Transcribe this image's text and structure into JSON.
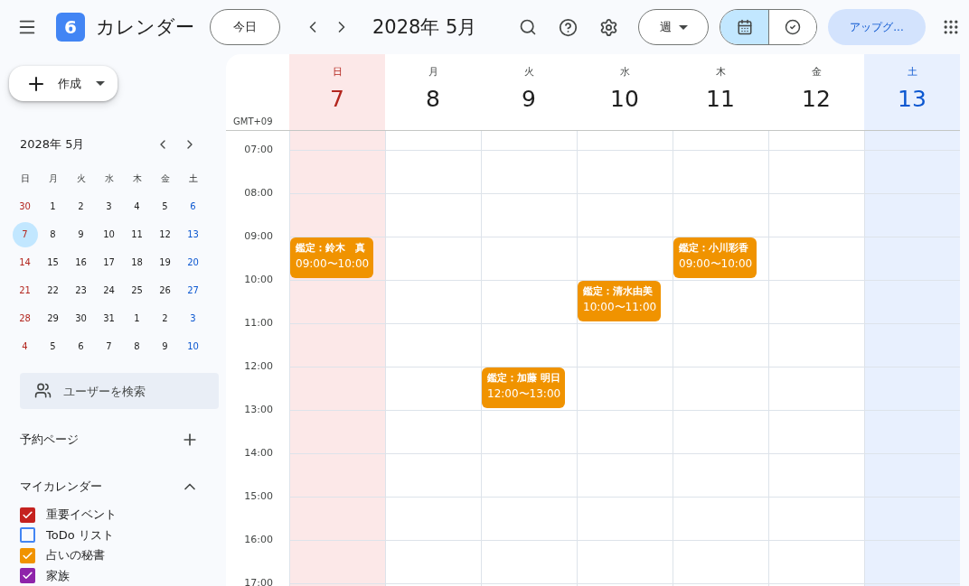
{
  "app": {
    "logo_text": "6",
    "title": "カレンダー"
  },
  "toolbar": {
    "today": "今日",
    "period": "2028年 5月",
    "view": "週",
    "view_mode": [
      {
        "kind": "calendar",
        "selected": true
      },
      {
        "kind": "tasks",
        "selected": false
      }
    ],
    "upgrade": "アップグ..."
  },
  "create_button": "作成",
  "mini_calendar": {
    "title": "2028年 5月",
    "weekdays": [
      {
        "label": "日",
        "kind": "sunday"
      },
      {
        "label": "月",
        "kind": "weekday"
      },
      {
        "label": "火",
        "kind": "weekday"
      },
      {
        "label": "水",
        "kind": "weekday"
      },
      {
        "label": "木",
        "kind": "weekday"
      },
      {
        "label": "金",
        "kind": "weekday"
      },
      {
        "label": "土",
        "kind": "saturday"
      }
    ],
    "weeks": [
      [
        {
          "d": "30",
          "selected": false
        },
        {
          "d": "1",
          "selected": false
        },
        {
          "d": "2",
          "selected": false
        },
        {
          "d": "3",
          "selected": false
        },
        {
          "d": "4",
          "selected": false
        },
        {
          "d": "5",
          "selected": false
        },
        {
          "d": "6",
          "selected": false
        }
      ],
      [
        {
          "d": "7",
          "selected": true
        },
        {
          "d": "8",
          "selected": false
        },
        {
          "d": "9",
          "selected": false
        },
        {
          "d": "10",
          "selected": false
        },
        {
          "d": "11",
          "selected": false
        },
        {
          "d": "12",
          "selected": false
        },
        {
          "d": "13",
          "selected": false
        }
      ],
      [
        {
          "d": "14",
          "selected": false
        },
        {
          "d": "15",
          "selected": false
        },
        {
          "d": "16",
          "selected": false
        },
        {
          "d": "17",
          "selected": false
        },
        {
          "d": "18",
          "selected": false
        },
        {
          "d": "19",
          "selected": false
        },
        {
          "d": "20",
          "selected": false
        }
      ],
      [
        {
          "d": "21",
          "selected": false
        },
        {
          "d": "22",
          "selected": false
        },
        {
          "d": "23",
          "selected": false
        },
        {
          "d": "24",
          "selected": false
        },
        {
          "d": "25",
          "selected": false
        },
        {
          "d": "26",
          "selected": false
        },
        {
          "d": "27",
          "selected": false
        }
      ],
      [
        {
          "d": "28",
          "selected": false
        },
        {
          "d": "29",
          "selected": false
        },
        {
          "d": "30",
          "selected": false
        },
        {
          "d": "31",
          "selected": false
        },
        {
          "d": "1",
          "selected": false
        },
        {
          "d": "2",
          "selected": false
        },
        {
          "d": "3",
          "selected": false
        }
      ],
      [
        {
          "d": "4",
          "selected": false
        },
        {
          "d": "5",
          "selected": false
        },
        {
          "d": "6",
          "selected": false
        },
        {
          "d": "7",
          "selected": false
        },
        {
          "d": "8",
          "selected": false
        },
        {
          "d": "9",
          "selected": false
        },
        {
          "d": "10",
          "selected": false
        }
      ]
    ]
  },
  "user_search": {
    "placeholder": "ユーザーを検索"
  },
  "booking_pages": {
    "title": "予約ページ"
  },
  "my_calendars": {
    "title": "マイカレンダー",
    "expanded": true,
    "items": [
      {
        "label": "重要イベント",
        "checked": true,
        "color": "#c5221f"
      },
      {
        "label": "ToDo リスト",
        "checked": false,
        "color": "#4285f4"
      },
      {
        "label": "占いの秘書",
        "checked": true,
        "color": "#f09300"
      },
      {
        "label": "家族",
        "checked": true,
        "color": "#8e24aa"
      }
    ]
  },
  "week": {
    "timezone": "GMT+09",
    "hours": [
      "07:00",
      "08:00",
      "09:00",
      "10:00",
      "11:00",
      "12:00",
      "13:00",
      "14:00",
      "15:00",
      "16:00",
      "17:00"
    ],
    "days": [
      {
        "weekday": "日",
        "date": "7",
        "kind": "sunday",
        "events": [
          {
            "title": "鑑定：鈴木　真",
            "time": "09:00〜10:00"
          }
        ]
      },
      {
        "weekday": "月",
        "date": "8",
        "kind": "weekday"
      },
      {
        "weekday": "火",
        "date": "9",
        "kind": "weekday",
        "events": [
          {
            "title": "鑑定：加藤 明日",
            "time": "12:00〜13:00"
          }
        ]
      },
      {
        "weekday": "水",
        "date": "10",
        "kind": "weekday",
        "events": [
          {
            "title": "鑑定：清水由美",
            "time": "10:00〜11:00"
          }
        ]
      },
      {
        "weekday": "木",
        "date": "11",
        "kind": "weekday",
        "events": [
          {
            "title": "鑑定：小川彩香",
            "time": "09:00〜10:00"
          }
        ]
      },
      {
        "weekday": "金",
        "date": "12",
        "kind": "weekday"
      },
      {
        "weekday": "土",
        "date": "13",
        "kind": "saturday"
      }
    ]
  }
}
